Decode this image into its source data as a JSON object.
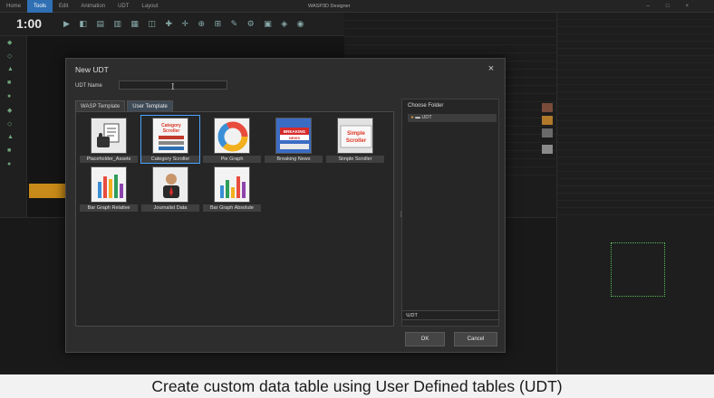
{
  "app": {
    "tabs": [
      "Home",
      "Tools",
      "Edit",
      "Animation",
      "UDT",
      "Layout"
    ],
    "active_tab": "Tools",
    "title": "WASP3D Designer",
    "timecode": "1:00"
  },
  "dialog": {
    "title": "New UDT",
    "close_glyph": "×",
    "udt_name_label": "UDT Name",
    "udt_name_value": "",
    "tabs": [
      {
        "label": "WASP Template"
      },
      {
        "label": "User Template"
      }
    ],
    "templates": [
      {
        "label": "Placeholder_Assets",
        "icon": "document-hand-icon",
        "thumb": ""
      },
      {
        "label": "Category Scroller",
        "icon": "category-scroller-icon",
        "thumb": "Category Scroller"
      },
      {
        "label": "Pie Graph",
        "icon": "pie-chart-icon",
        "thumb": ""
      },
      {
        "label": "Breaking News",
        "icon": "breaking-news-icon",
        "thumb": "BREAKING NEWS"
      },
      {
        "label": "Simple Scroller",
        "icon": "simple-scroller-icon",
        "thumb": "Simple Scroller"
      },
      {
        "label": "Bar Graph Relative",
        "icon": "bar-chart-icon",
        "thumb": ""
      },
      {
        "label": "Journalist Data",
        "icon": "journalist-icon",
        "thumb": ""
      },
      {
        "label": "Bar Graph Absolute",
        "icon": "bar-chart-absolute-icon",
        "thumb": ""
      }
    ],
    "selected_template": "Category Scroller",
    "choose_folder": {
      "title": "Choose Folder",
      "items": [
        {
          "label": "UDT",
          "icon": "folder-icon"
        }
      ]
    },
    "folder_value": "\\UDT",
    "buttons": {
      "ok": "OK",
      "cancel": "Cancel"
    }
  },
  "caption": "Create custom data table using User Defined tables (UDT)",
  "colors": {
    "accent": "#4aa3ff",
    "dialog_bg": "#2d2d2d",
    "orange": "#c88a18"
  }
}
